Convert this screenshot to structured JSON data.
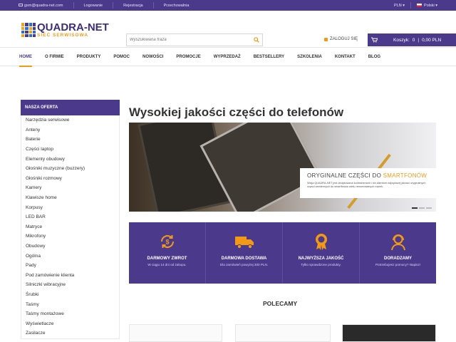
{
  "topbar": {
    "email": "gsm@quadra-net.com",
    "links": [
      "Logowanie",
      "Rejestracja",
      "Przechowalnia"
    ],
    "currency": "PLN",
    "language": "Polski"
  },
  "header": {
    "logo_title": "QUADRA-NET",
    "logo_subtitle": "SIEĆ SERWISOWA",
    "search_placeholder": "Wyszukiwana fraza",
    "login_label": "ZALOGUJ SIĘ",
    "cart_label": "Koszyk:",
    "cart_count": "0",
    "cart_total": "0,00 PLN"
  },
  "nav": {
    "items": [
      "HOME",
      "O FIRMIE",
      "PRODUKTY",
      "POMOC",
      "NOWOŚCI",
      "PROMOCJE",
      "WYPRZEDAŻ",
      "BESTSELLERY",
      "SZKOLENIA",
      "KONTAKT",
      "BLOG"
    ],
    "active": "HOME"
  },
  "sidebar": {
    "heading": "NASZA OFERTA",
    "items": [
      "Narzędzia serwisowe",
      "Anteny",
      "Baterie",
      "Części laptop",
      "Elementy obudowy",
      "Głośniki muzyczne (buzzery)",
      "Głośniki rozmowy",
      "Kamery",
      "Klawisze home",
      "Korpusy",
      "LED BAR",
      "Matryce",
      "Mikrofony",
      "Obudowy",
      "Ogólna",
      "Pady",
      "Pod zamówienie klienta",
      "Silniczki wibracyjne",
      "Śrubki",
      "Taśmy",
      "Taśmy montażowe",
      "Wyświetlacze",
      "Zasilacze"
    ]
  },
  "main": {
    "title": "Wysokiej jakości części do telefonów",
    "banner_heading_prefix": "ORYGINALNE CZĘŚCI DO ",
    "banner_heading_accent": "SMARTFONÓW",
    "banner_text": "Wizja QUADRA-NET jest dedykowana kontrahentom i ich klientom najwyższej jakości oryginalnych części zamiennych do smartfonów wielu renomowanych marek.",
    "features": [
      {
        "title": "DARMOWY ZWROT",
        "subtitle": "W ciągu 14 dni od zakupu.",
        "icon": "refund-icon"
      },
      {
        "title": "DARMOWA DOSTAWA",
        "subtitle": "Dla zamówień powyżej 300 PLN.",
        "icon": "truck-icon"
      },
      {
        "title": "NAJWYŻSZA JAKOŚĆ",
        "subtitle": "Tylko sprawdzone produkty.",
        "icon": "quality-badge-icon"
      },
      {
        "title": "DORADZAMY",
        "subtitle": "Potrzebujesz pomocy? Napisz!",
        "icon": "support-agent-icon"
      }
    ],
    "recommended_heading": "POLECAMY"
  },
  "colors": {
    "brand_purple": "#4b3a8c",
    "accent_orange": "#f29a16"
  }
}
